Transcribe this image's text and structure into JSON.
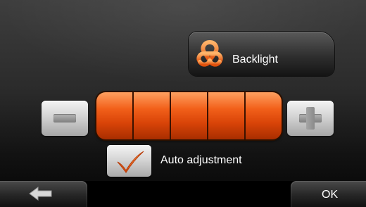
{
  "header": {
    "title": "Backlight",
    "icon": "backlight-ribbon-icon",
    "icon_color": "#f07a1a"
  },
  "brightness": {
    "segments_total": 5,
    "segments_filled": 5,
    "fill_color": "#e8520e",
    "decrease_icon": "minus-icon",
    "increase_icon": "plus-icon"
  },
  "auto_adjust": {
    "label": "Auto adjustment",
    "checked": true,
    "icon": "checkmark-icon",
    "check_color": "#f07a1a"
  },
  "footer": {
    "back_icon": "back-arrow-icon",
    "ok_label": "OK"
  }
}
